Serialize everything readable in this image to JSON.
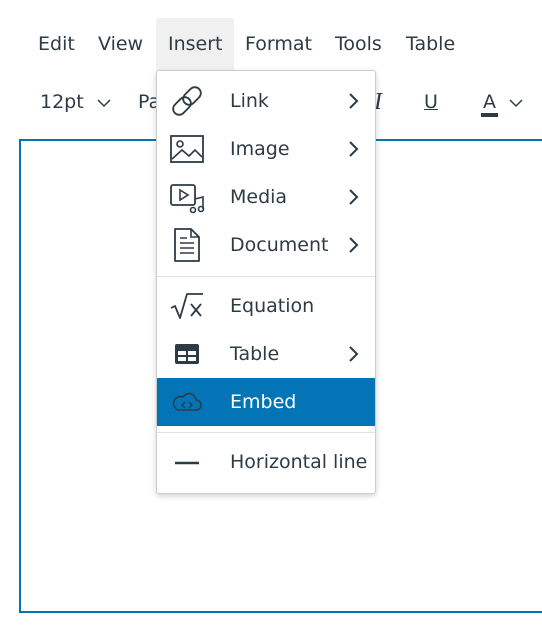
{
  "menubar": {
    "items": [
      {
        "label": "Edit"
      },
      {
        "label": "View"
      },
      {
        "label": "Insert"
      },
      {
        "label": "Format"
      },
      {
        "label": "Tools"
      },
      {
        "label": "Table"
      }
    ],
    "active": "Insert"
  },
  "toolbar": {
    "font_size": "12pt",
    "paragraph_partial": "Pa",
    "italic_glyph": "I",
    "underline_glyph": "U",
    "text_color_glyph": "A"
  },
  "insert_menu": {
    "items": [
      {
        "label": "Link",
        "icon": "link-icon",
        "submenu": true
      },
      {
        "label": "Image",
        "icon": "image-icon",
        "submenu": true
      },
      {
        "label": "Media",
        "icon": "media-icon",
        "submenu": true
      },
      {
        "label": "Document",
        "icon": "document-icon",
        "submenu": true
      },
      {
        "label": "Equation",
        "icon": "equation-icon",
        "submenu": false
      },
      {
        "label": "Table",
        "icon": "table-icon",
        "submenu": true
      },
      {
        "label": "Embed",
        "icon": "embed-cloud-icon",
        "submenu": false,
        "highlighted": true
      },
      {
        "label": "Horizontal line",
        "icon": "horizontal-line-icon",
        "submenu": false
      }
    ]
  },
  "colors": {
    "accent": "#0374b5",
    "text": "#2d3b45",
    "active_menu_bg": "#f0f0f0",
    "text_color_bar": "#2d3b45"
  }
}
